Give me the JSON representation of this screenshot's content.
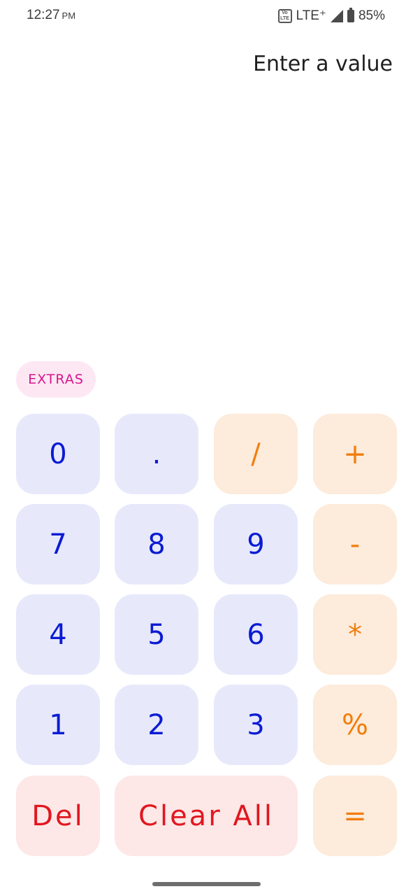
{
  "status_bar": {
    "time": "12:27",
    "ampm": "PM",
    "network": "LTE⁺",
    "battery": "85%",
    "icons": [
      "volte-icon",
      "signal-icon",
      "battery-icon"
    ]
  },
  "display": {
    "placeholder": "Enter a value"
  },
  "extras": {
    "label": "EXTRAS"
  },
  "keys": {
    "zero": "0",
    "dot": ".",
    "divide": "/",
    "plus": "+",
    "seven": "7",
    "eight": "8",
    "nine": "9",
    "minus": "-",
    "four": "4",
    "five": "5",
    "six": "6",
    "multiply": "*",
    "one": "1",
    "two": "2",
    "three": "3",
    "percent": "%",
    "del": "Del",
    "clear_all": "Clear All",
    "equals": "="
  },
  "colors": {
    "number_key_bg": "#e7e9fb",
    "number_key_text": "#0b1bd4",
    "operator_key_bg": "#fdebdb",
    "operator_key_text": "#f17e0c",
    "danger_key_bg": "#fde7e7",
    "danger_key_text": "#e1161e",
    "extras_bg": "#fde7f3",
    "extras_text": "#d6168c"
  }
}
